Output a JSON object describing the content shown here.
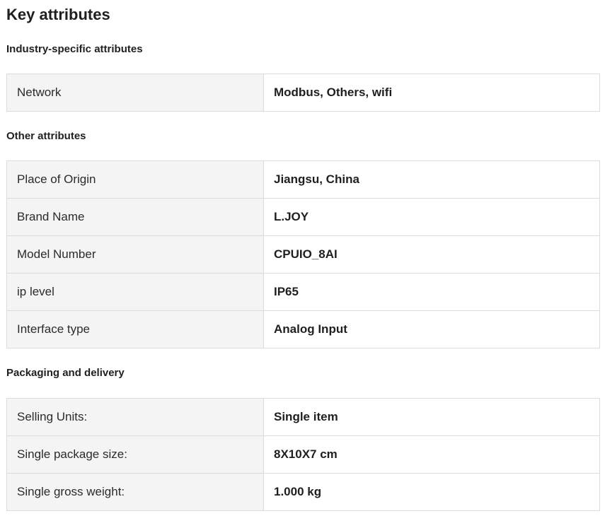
{
  "page": {
    "title": "Key attributes"
  },
  "sections": [
    {
      "title": "Industry-specific attributes",
      "rows": [
        {
          "label": "Network",
          "value": "Modbus, Others, wifi"
        }
      ]
    },
    {
      "title": "Other attributes",
      "rows": [
        {
          "label": "Place of Origin",
          "value": "Jiangsu, China"
        },
        {
          "label": "Brand Name",
          "value": "L.JOY"
        },
        {
          "label": "Model Number",
          "value": "CPUIO_8AI"
        },
        {
          "label": "ip level",
          "value": "IP65"
        },
        {
          "label": "Interface type",
          "value": "Analog Input"
        }
      ]
    },
    {
      "title": "Packaging and delivery",
      "rows": [
        {
          "label": "Selling Units:",
          "value": "Single item"
        },
        {
          "label": "Single package size:",
          "value": "8X10X7 cm"
        },
        {
          "label": "Single gross weight:",
          "value": "1.000 kg"
        }
      ]
    }
  ],
  "colors": {
    "key_cell_background": "#f4f4f4",
    "border": "#dcdcdc",
    "text": "#1f1f1f"
  }
}
